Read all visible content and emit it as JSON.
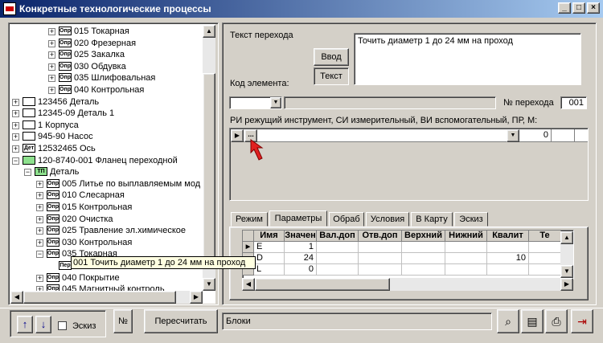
{
  "window": {
    "title": "Конкретные технологические процессы"
  },
  "tree": {
    "items": [
      {
        "indent": 3,
        "pm": "+",
        "icon": "Опр",
        "label": "015 Токарная"
      },
      {
        "indent": 3,
        "pm": "+",
        "icon": "Опр",
        "label": "020 Фрезерная"
      },
      {
        "indent": 3,
        "pm": "+",
        "icon": "Опр",
        "label": "025 Закалка"
      },
      {
        "indent": 3,
        "pm": "+",
        "icon": "Опр",
        "label": "030 Обдувка"
      },
      {
        "indent": 3,
        "pm": "+",
        "icon": "Опр",
        "label": "035 Шлифовальная"
      },
      {
        "indent": 3,
        "pm": "+",
        "icon": "Опр",
        "label": "040 Контрольная"
      },
      {
        "indent": 0,
        "pm": "+",
        "icon": "",
        "label": "123456 Деталь"
      },
      {
        "indent": 0,
        "pm": "+",
        "icon": "",
        "label": "12345-09 Деталь 1"
      },
      {
        "indent": 0,
        "pm": "+",
        "icon": "",
        "label": "1 Корпуса"
      },
      {
        "indent": 0,
        "pm": "+",
        "icon": "",
        "label": "945-90 Насос"
      },
      {
        "indent": 0,
        "pm": "+",
        "icon": "Дет",
        "label": "12532465 Ось"
      },
      {
        "indent": 0,
        "pm": "-",
        "icon": "green",
        "label": "120-8740-001 Фланец переходной"
      },
      {
        "indent": 1,
        "pm": "-",
        "icon": "ТП",
        "label": "Деталь"
      },
      {
        "indent": 2,
        "pm": "+",
        "icon": "Опр",
        "label": "005 Литье по выплавляемым мод"
      },
      {
        "indent": 2,
        "pm": "+",
        "icon": "Опр",
        "label": "010 Слесарная"
      },
      {
        "indent": 2,
        "pm": "+",
        "icon": "Опр",
        "label": "015 Контрольная"
      },
      {
        "indent": 2,
        "pm": "+",
        "icon": "Опр",
        "label": "020 Очистка"
      },
      {
        "indent": 2,
        "pm": "+",
        "icon": "Опр",
        "label": "025 Травление эл.химическое"
      },
      {
        "indent": 2,
        "pm": "+",
        "icon": "Опр",
        "label": "030 Контрольная"
      },
      {
        "indent": 2,
        "pm": "-",
        "icon": "Опр",
        "label": "035 Токарная"
      },
      {
        "indent": 3,
        "pm": "",
        "icon": "Пер",
        "label": ""
      },
      {
        "indent": 2,
        "pm": "+",
        "icon": "Опр",
        "label": "040 Покрытие"
      },
      {
        "indent": 2,
        "pm": "+",
        "icon": "Опр",
        "label": "045 Магнитный контроль"
      }
    ],
    "tooltip": "001 Точить диаметр 1 до 24 мм на проход"
  },
  "transition": {
    "text_label": "Текст перехода",
    "input_button": "Ввод",
    "text_button": "Текст",
    "text_value": "Точить диаметр 1 до 24 мм на проход",
    "element_code_label": "Код элемента:",
    "number_label": "№ перехода",
    "number_value": "001"
  },
  "tools": {
    "label": "РИ режущий инструмент, СИ измерительный, ВИ вспомогательный, ПР, М:",
    "ellipsis": "...",
    "qty": "0"
  },
  "tabs": [
    {
      "label": "Режим",
      "active": false
    },
    {
      "label": "Параметры",
      "active": true
    },
    {
      "label": "Обраб",
      "active": false
    },
    {
      "label": "Условия",
      "active": false
    },
    {
      "label": "В Карту",
      "active": false
    },
    {
      "label": "Эскиз",
      "active": false
    }
  ],
  "params_grid": {
    "headers": [
      "Имя",
      "Значен",
      "Вал.доп",
      "Отв.доп",
      "Верхний",
      "Нижний",
      "Квалит",
      "Те"
    ],
    "rows": [
      [
        "E",
        "1",
        "",
        "",
        "",
        "",
        "",
        ""
      ],
      [
        "D",
        "24",
        "",
        "",
        "",
        "",
        "10",
        ""
      ],
      [
        "L",
        "0",
        "",
        "",
        "",
        "",
        "",
        ""
      ]
    ]
  },
  "bottom": {
    "sketch_label": "Эскиз",
    "number_button": "№",
    "recalc_button": "Пересчитать",
    "blocks_label": "Блоки"
  }
}
